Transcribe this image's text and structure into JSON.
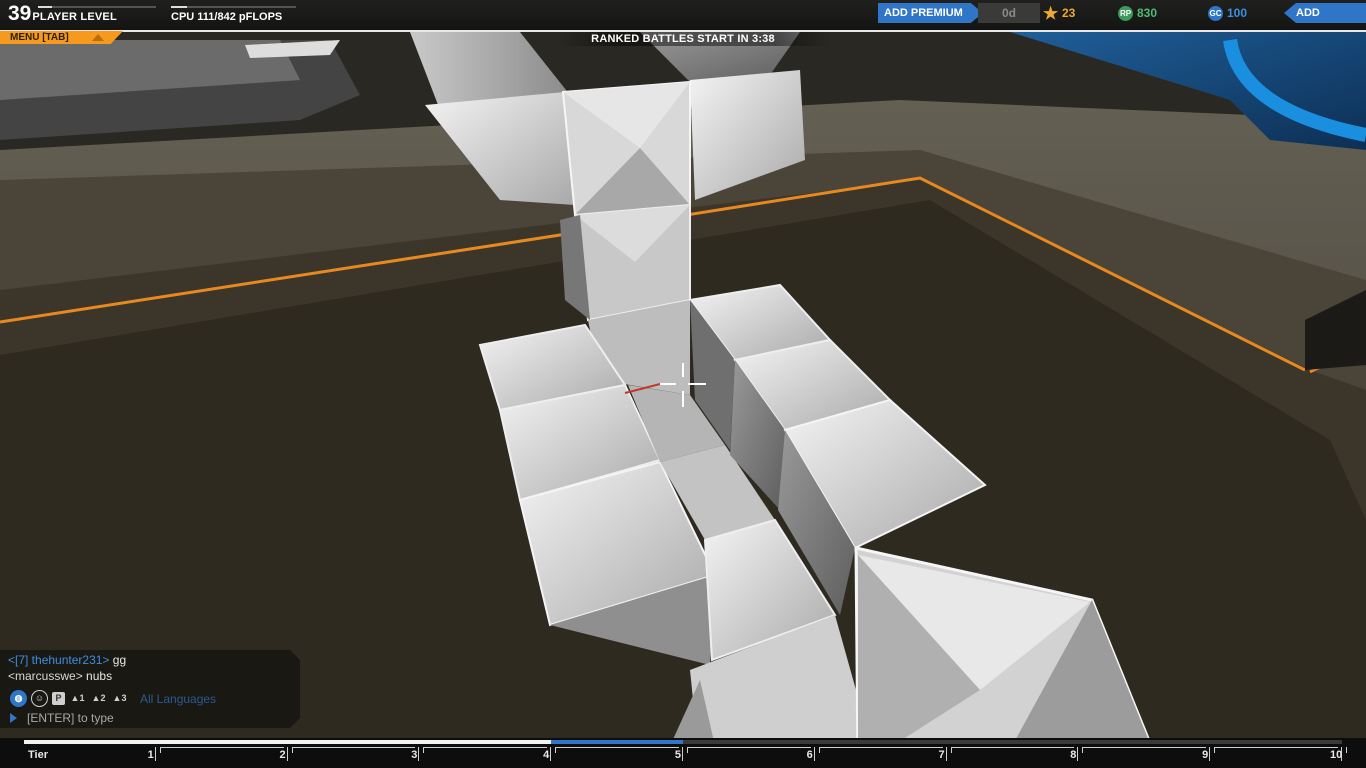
{
  "player": {
    "level": "39",
    "level_label": "PLAYER LEVEL",
    "level_progress": 0.12
  },
  "cpu": {
    "text": "CPU 111/842 pFLOPS",
    "used": 111,
    "max": 842
  },
  "premium": {
    "button_label": "ADD PREMIUM",
    "days": "0d"
  },
  "currency": {
    "stars": "23",
    "rp": "830",
    "rp_icon_label": "RP",
    "gc": "100",
    "gc_icon_label": "GC"
  },
  "funds": {
    "button_label": "ADD FUNDS"
  },
  "menu": {
    "label": "MENU [TAB]"
  },
  "ranked": {
    "text": "RANKED BATTLES START IN 3:38"
  },
  "chat": {
    "messages": [
      {
        "sender": "<[7] thehunter231>",
        "text": "gg"
      },
      {
        "sender": "<marcusswe>",
        "text": "nubs"
      }
    ],
    "icons": [
      "globe-icon",
      "person-icon",
      "party-icon",
      "user-1-icon",
      "user-2-icon",
      "user-3-icon"
    ],
    "language": "All Languages",
    "input_placeholder": "[ENTER] to type"
  },
  "tier_bar": {
    "label": "Tier",
    "tiers": [
      "1",
      "2",
      "3",
      "4",
      "5",
      "6",
      "7",
      "8",
      "9",
      "10"
    ],
    "progress": 0.45,
    "current_range": [
      0.4,
      0.5
    ]
  },
  "colors": {
    "accent_blue": "#2f76c8",
    "menu_orange": "#f59a1c",
    "rp_green": "#4fb873",
    "star_gold": "#f0a830"
  }
}
